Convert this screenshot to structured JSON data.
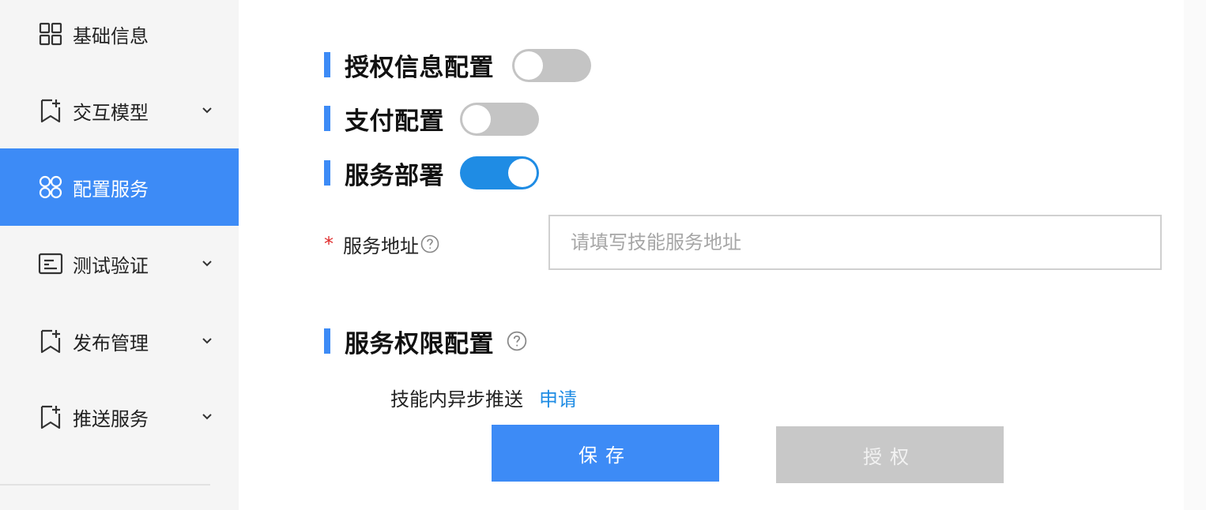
{
  "sidebar": {
    "items": [
      {
        "label": "基础信息",
        "icon": "grid-icon",
        "has_chevron": false,
        "active": false
      },
      {
        "label": "交互模型",
        "icon": "bookmark-add-icon",
        "has_chevron": true,
        "active": false
      },
      {
        "label": "配置服务",
        "icon": "four-circles-icon",
        "has_chevron": false,
        "active": true
      },
      {
        "label": "测试验证",
        "icon": "terminal-icon",
        "has_chevron": true,
        "active": false
      },
      {
        "label": "发布管理",
        "icon": "bookmark-add-icon",
        "has_chevron": true,
        "active": false
      },
      {
        "label": "推送服务",
        "icon": "bookmark-add-icon",
        "has_chevron": true,
        "active": false
      }
    ]
  },
  "sections": {
    "auth_info": {
      "title": "授权信息配置",
      "toggle": "off"
    },
    "payment": {
      "title": "支付配置",
      "toggle": "off"
    },
    "deploy": {
      "title": "服务部署",
      "toggle": "on"
    },
    "permission": {
      "title": "服务权限配置"
    }
  },
  "service_address": {
    "required_mark": "*",
    "label": "服务地址",
    "value": "",
    "placeholder": "请填写技能服务地址"
  },
  "permission_row": {
    "text": "技能内异步推送",
    "link": "申请"
  },
  "buttons": {
    "save": "保存",
    "authorize": "授权"
  },
  "colors": {
    "accent": "#3d8bf6",
    "toggle_on": "#1f8ce4",
    "toggle_off": "#c4c4c4",
    "required": "#e02c2c",
    "disabled_button": "#c8c8c8",
    "sidebar_bg": "#f5f5f5"
  }
}
